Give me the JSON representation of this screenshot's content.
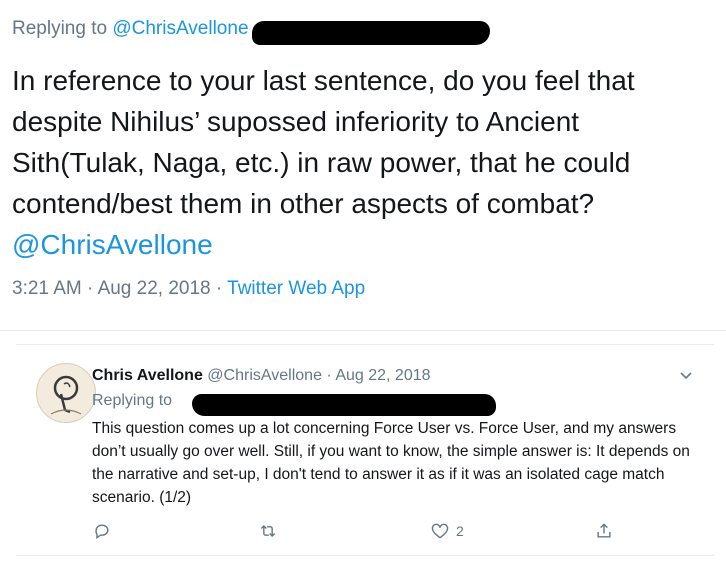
{
  "main_tweet": {
    "replying_prefix": "Replying to ",
    "replying_handle": "@ChrisAvellone",
    "text": "In reference to your last sentence, do you feel that despite Nihilus’ supossed inferiority to Ancient Sith(Tulak, Naga, etc.) in raw power, that he could contend/best them in other aspects of combat?",
    "mention": "@ChrisAvellone",
    "time": "3:21 AM",
    "sep1": " · ",
    "date": "Aug 22, 2018",
    "sep2": " · ",
    "source": "Twitter Web App"
  },
  "reply_tweet": {
    "name": "Chris Avellone",
    "handle": "@ChrisAvellone",
    "sep": " · ",
    "date": "Aug 22, 2018",
    "replying_label": "Replying to",
    "text": "This question comes up a lot concerning Force User vs. Force User, and my answers don’t usually go over well. Still, if you want to know, the simple answer is: It depends on the narrative and set-up, I don't tend to answer it as if it was an isolated cage match scenario. (1/2)",
    "actions": {
      "reply_count": "",
      "retweet_count": "",
      "like_count": "2"
    }
  },
  "colors": {
    "link": "#1b95e0",
    "muted": "#657786",
    "text": "#14171a"
  }
}
